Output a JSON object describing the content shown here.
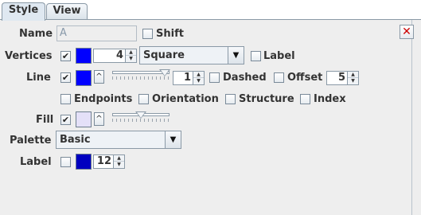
{
  "tabs": [
    {
      "label": "Style",
      "active": true
    },
    {
      "label": "View",
      "active": false
    }
  ],
  "close_icon": "close-x-icon",
  "name": {
    "label": "Name",
    "value": "A",
    "shift": {
      "label": "Shift",
      "checked": false
    }
  },
  "vertices": {
    "label": "Vertices",
    "checked": true,
    "color": "#0000ff",
    "size": "4",
    "shape": "Square",
    "show_label": {
      "label": "Label",
      "checked": false
    }
  },
  "line": {
    "label": "Line",
    "checked": true,
    "color": "#0000ff",
    "opacity_fraction": 0.92,
    "width": "1",
    "dashed": {
      "label": "Dashed",
      "checked": false
    },
    "offset": {
      "label": "Offset",
      "checked": false,
      "value": "5"
    }
  },
  "options": [
    {
      "label": "Endpoints",
      "checked": false
    },
    {
      "label": "Orientation",
      "checked": false
    },
    {
      "label": "Structure",
      "checked": false
    },
    {
      "label": "Index",
      "checked": false
    }
  ],
  "fill": {
    "label": "Fill",
    "checked": true,
    "color": "#e4e0f8",
    "opacity_fraction": 0.5
  },
  "palette": {
    "label": "Palette",
    "value": "Basic"
  },
  "label_row": {
    "label": "Label",
    "checked": false,
    "color": "#0000c0",
    "size": "12"
  },
  "colors": {
    "accent": "#0000ff",
    "close": "#cc0000"
  }
}
